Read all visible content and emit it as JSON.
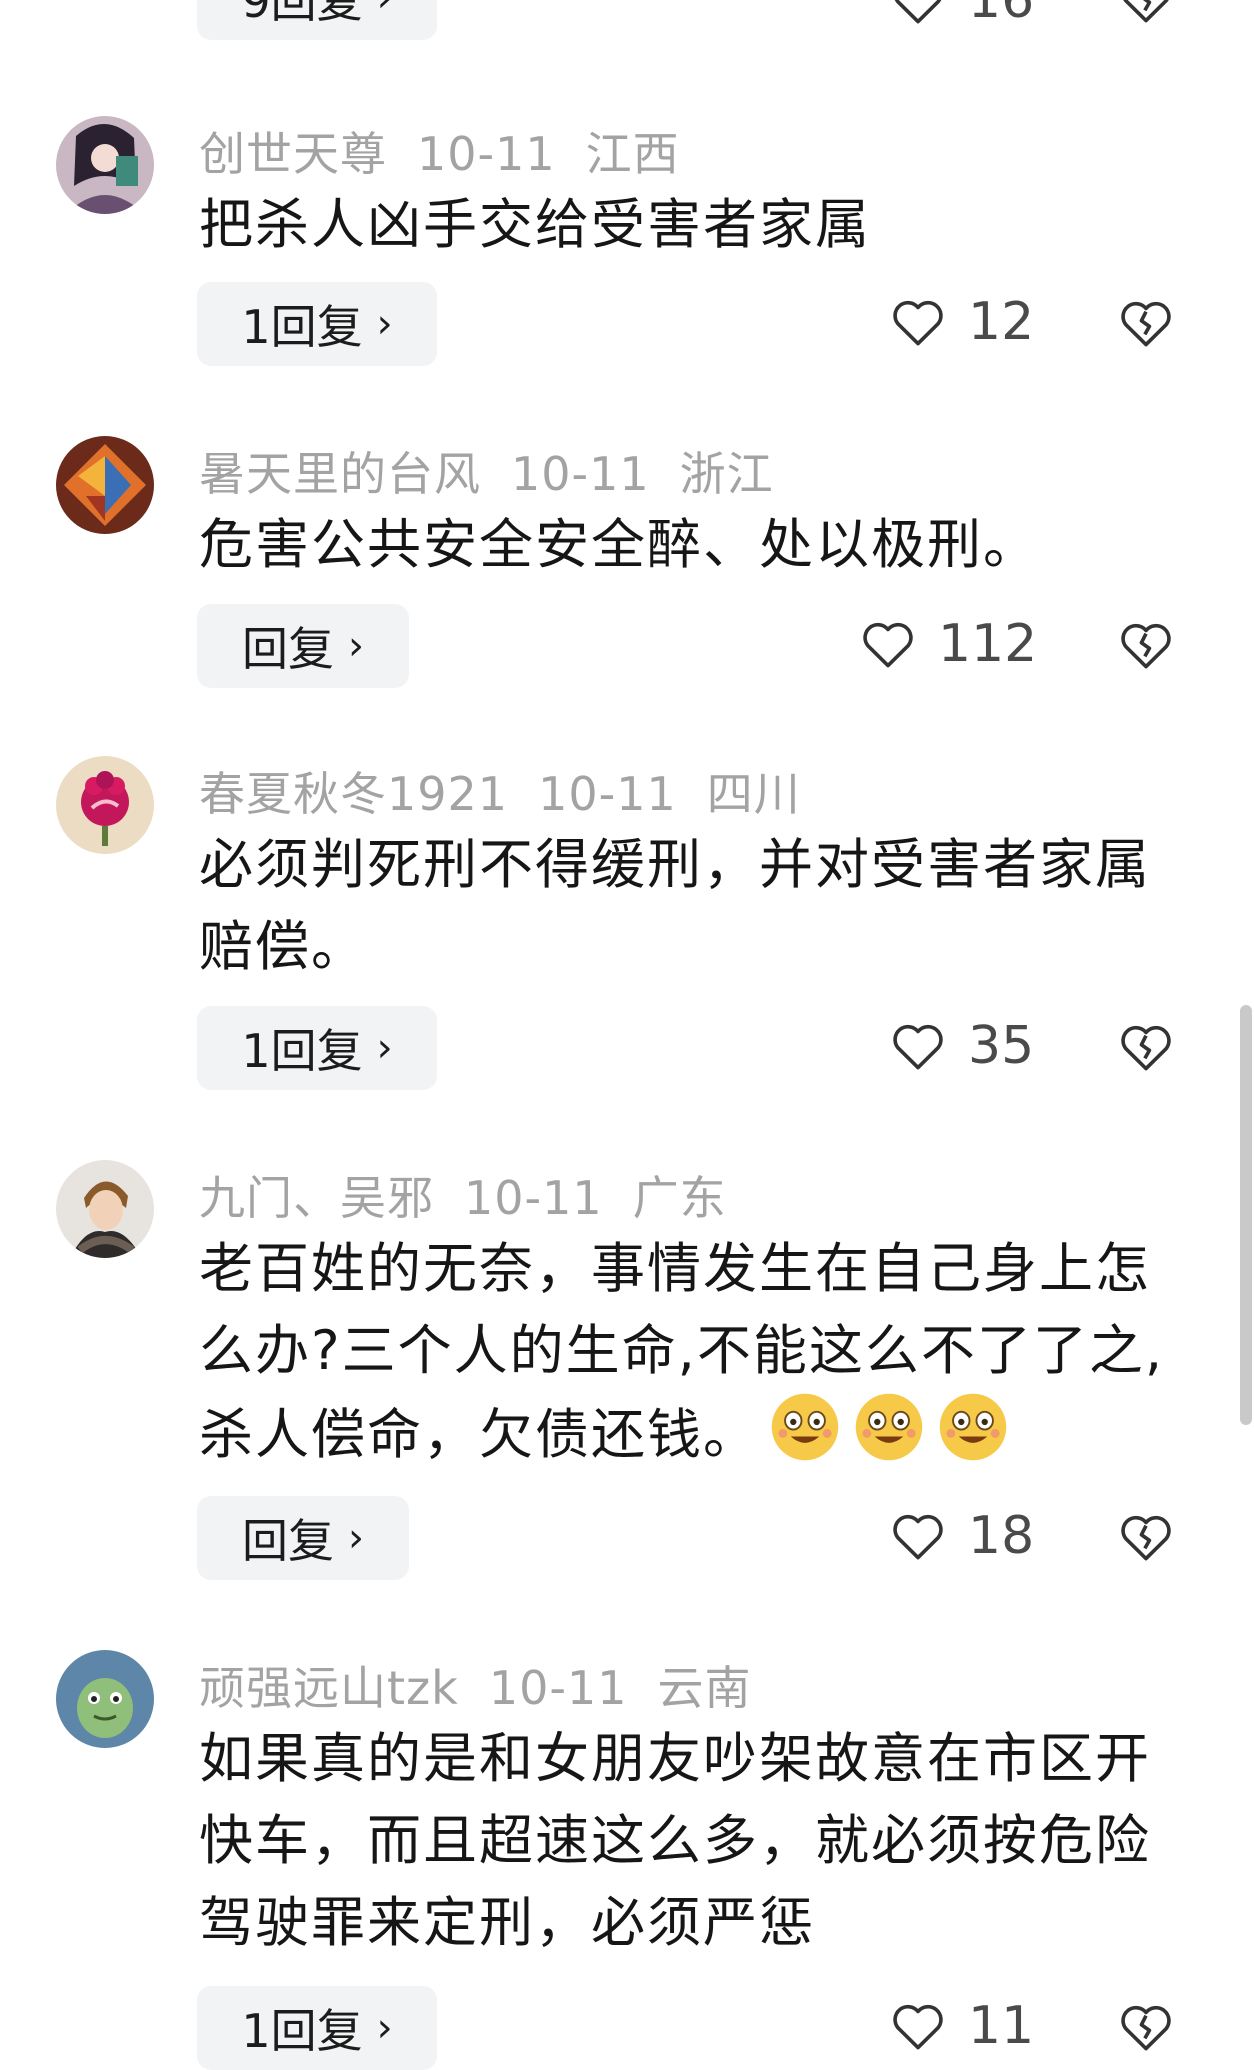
{
  "top_partial": {
    "reply_label": "9回复",
    "likes": "16"
  },
  "comments": [
    {
      "user": "创世天尊",
      "date": "10-11",
      "region": "江西",
      "text": "把杀人凶手交给受害者家属",
      "reply_label": "1回复",
      "likes": "12"
    },
    {
      "user": "暑天里的台风",
      "date": "10-11",
      "region": "浙江",
      "text": "危害公共安全安全醉、处以极刑。",
      "reply_label": "回复",
      "likes": "112"
    },
    {
      "user": "春夏秋冬1921",
      "date": "10-11",
      "region": "四川",
      "text": "必须判死刑不得缓刑，并对受害者家属赔偿。",
      "reply_label": "1回复",
      "likes": "35"
    },
    {
      "user": "九门、吴邪",
      "date": "10-11",
      "region": "广东",
      "text": "老百姓的无奈，事情发生在自己身上怎么办?三个人的生命,不能这么不了了之,杀人偿命，欠债还钱。",
      "reply_label": "回复",
      "likes": "18"
    },
    {
      "user": "顽强远山tzk",
      "date": "10-11",
      "region": "云南",
      "text": "如果真的是和女朋友吵架故意在市区开快车，而且超速这么多，就必须按危险驾驶罪来定刑，必须严惩",
      "reply_label": "1回复",
      "likes": "11"
    }
  ],
  "icons": {
    "like": "heart-outline-icon",
    "dislike": "broken-heart-icon",
    "chevron": "chevron-right-icon",
    "emoji": "laughing-face-emoji"
  }
}
